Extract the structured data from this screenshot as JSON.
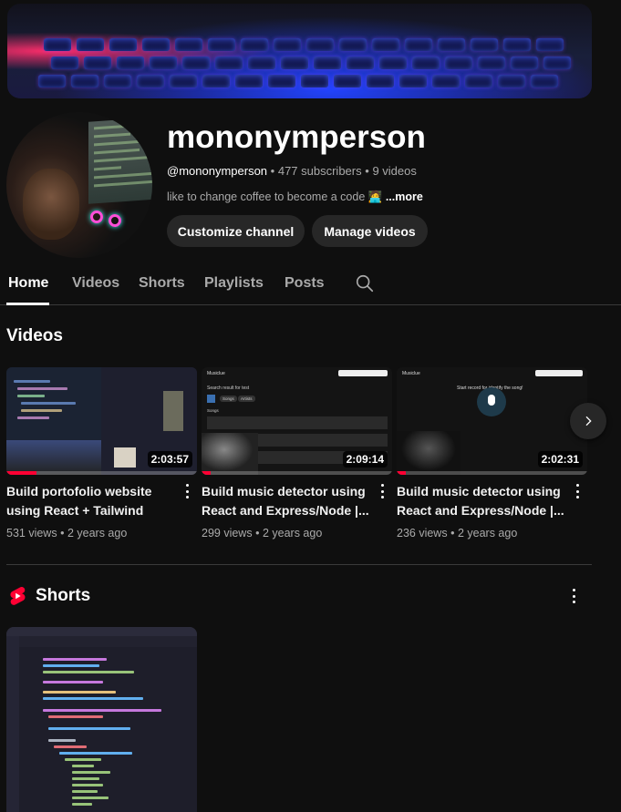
{
  "channel": {
    "name": "mononymperson",
    "handle": "@mononymperson",
    "subscribers": "477 subscribers",
    "video_count": "9 videos",
    "separator": "•",
    "description": "like to change coffee to become a code 🧑‍💻",
    "more_label": "...more"
  },
  "actions": {
    "customize": "Customize channel",
    "manage": "Manage videos"
  },
  "tabs": [
    {
      "label": "Home",
      "active": true
    },
    {
      "label": "Videos",
      "active": false
    },
    {
      "label": "Shorts",
      "active": false
    },
    {
      "label": "Playlists",
      "active": false
    },
    {
      "label": "Posts",
      "active": false
    }
  ],
  "sections": {
    "videos_title": "Videos",
    "shorts_title": "Shorts"
  },
  "videos": [
    {
      "title_line1": "Build portofolio website",
      "title_line2": "using React + Tailwind",
      "duration": "2:03:57",
      "views": "531 views",
      "age": "2 years ago",
      "watched": 0.16
    },
    {
      "title_line1": "Build music detector using",
      "title_line2": "React and Express/Node |...",
      "duration": "2:09:14",
      "views": "299 views",
      "age": "2 years ago",
      "watched": 0.05
    },
    {
      "title_line1": "Build music detector using",
      "title_line2": "React and Express/Node |...",
      "duration": "2:02:31",
      "views": "236 views",
      "age": "2 years ago",
      "watched": 0.05
    }
  ],
  "thumb_text": {
    "musiclue": "Musiclue",
    "search_result": "Search result for test",
    "songs_chip": "Songs",
    "artists_chip": "Artists",
    "songs_heading": "Songs",
    "start_record": "Start record for identify the song!"
  },
  "colors": {
    "background": "#0f0f0f",
    "pill": "#272727",
    "progress": "#ff0033",
    "shorts_logo": "#ff0033"
  },
  "icons": {
    "search": "search-icon",
    "next": "chevron-right-icon",
    "more": "more-vert-icon",
    "shorts": "shorts-logo-icon"
  }
}
